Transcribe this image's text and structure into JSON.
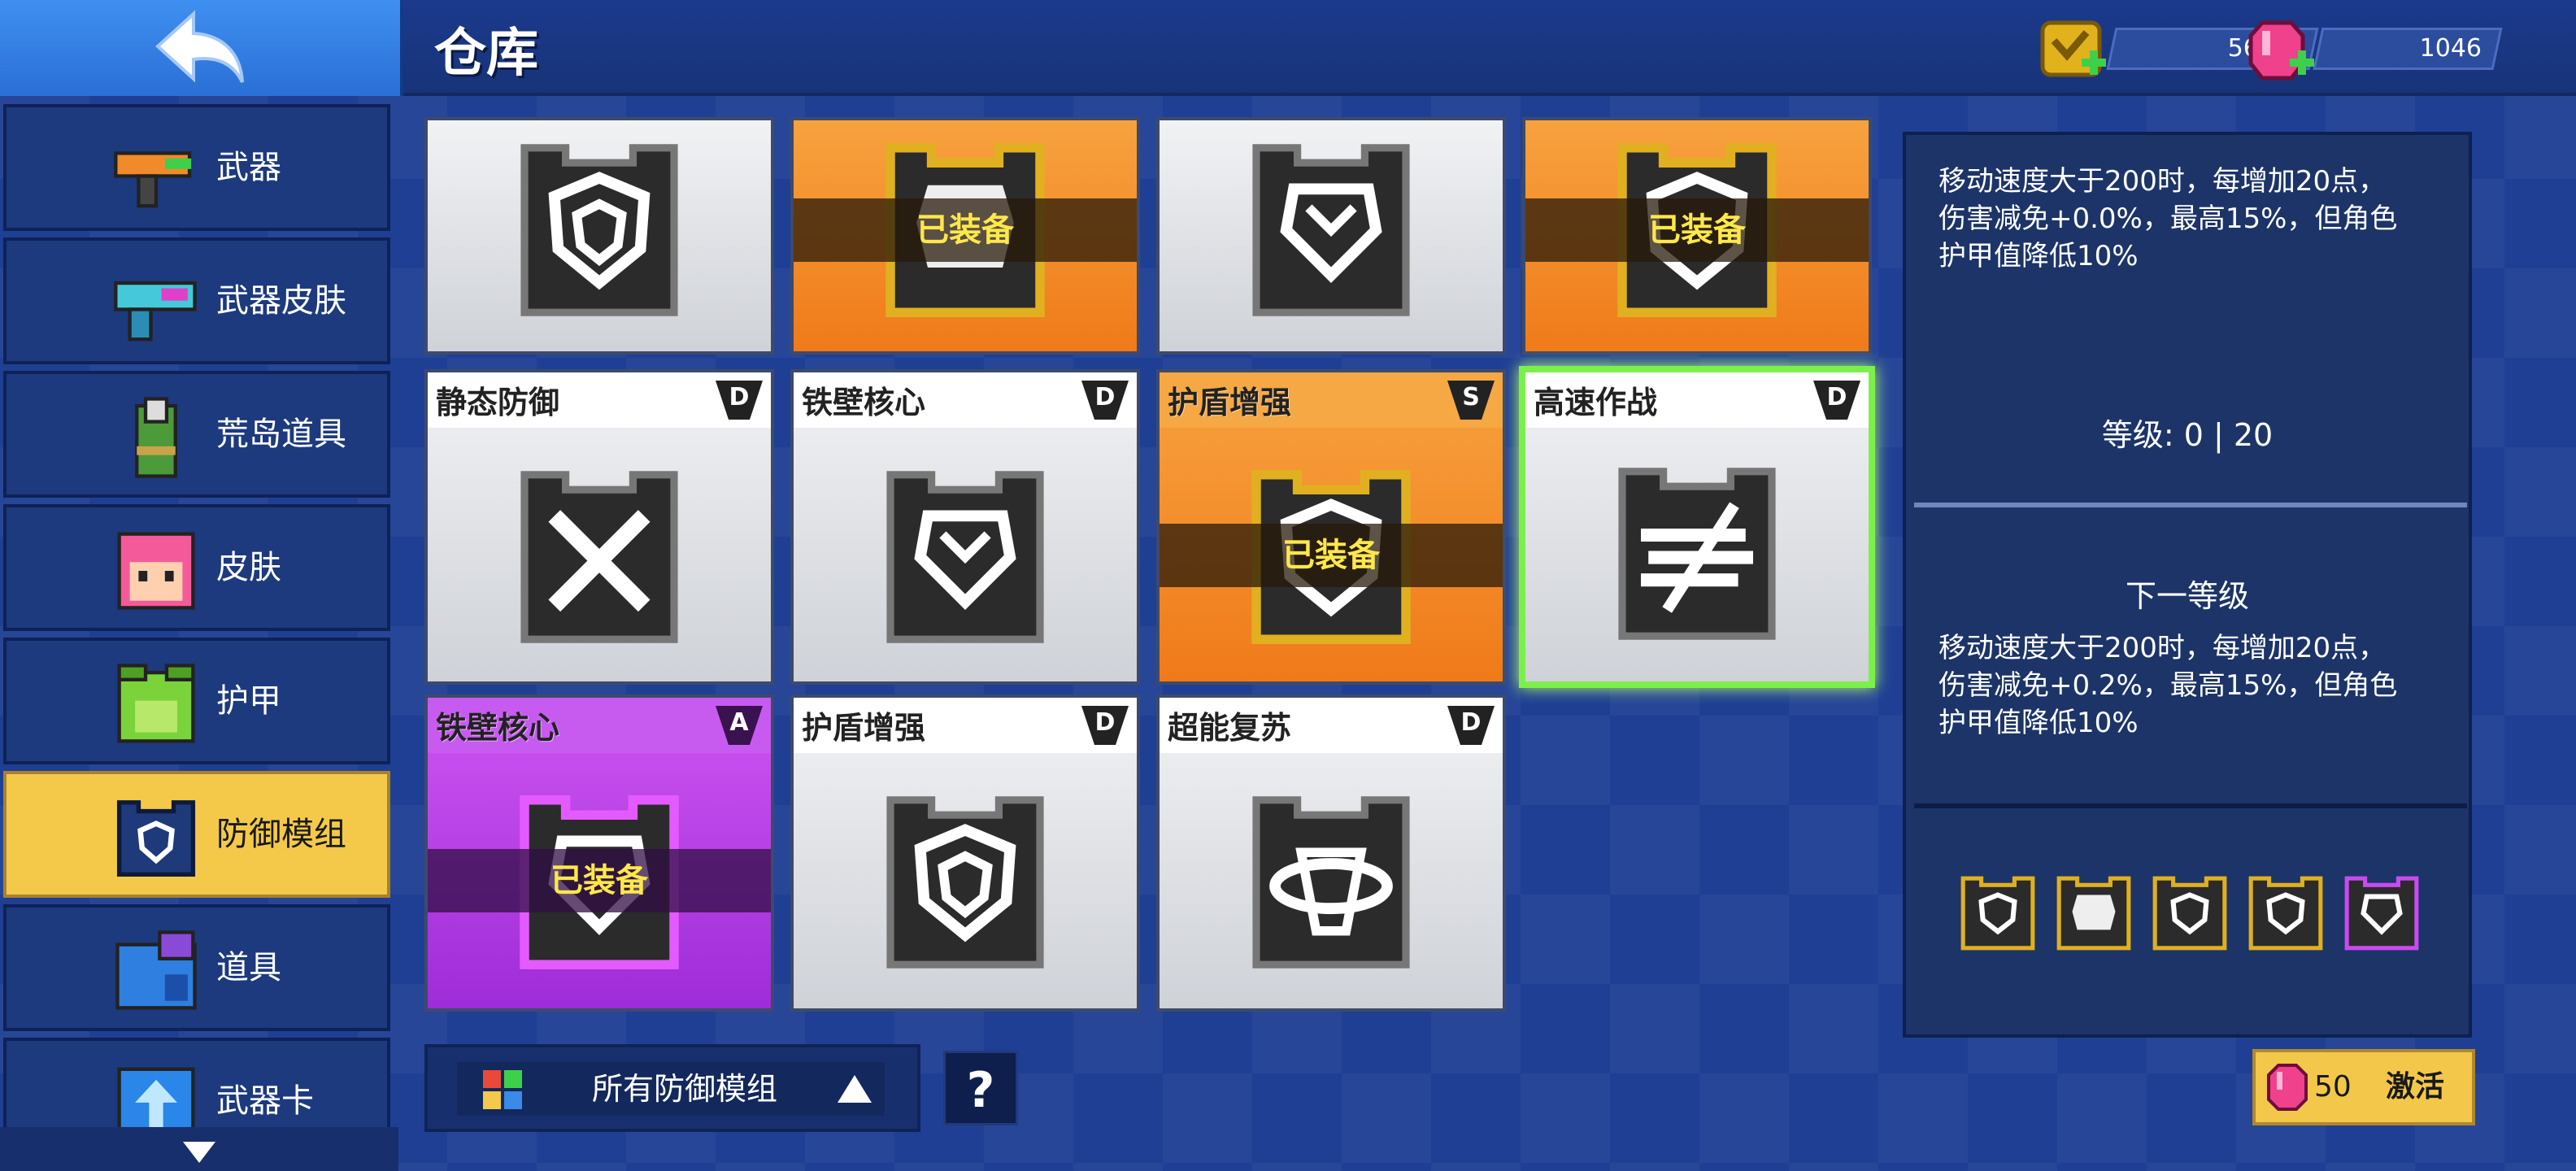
{
  "header": {
    "title": "仓库",
    "coins": "5675",
    "gems": "1046"
  },
  "sidebar": {
    "items": [
      {
        "label": "武器",
        "icon": "weapon-icon"
      },
      {
        "label": "武器皮肤",
        "icon": "weapon-skin-icon"
      },
      {
        "label": "荒岛道具",
        "icon": "island-item-icon"
      },
      {
        "label": "皮肤",
        "icon": "skin-icon"
      },
      {
        "label": "护甲",
        "icon": "armor-icon"
      },
      {
        "label": "防御模组",
        "icon": "defense-module-icon"
      },
      {
        "label": "道具",
        "icon": "item-icon"
      },
      {
        "label": "武器卡",
        "icon": "weapon-card-icon"
      }
    ],
    "active_index": 5
  },
  "grid": {
    "equipped_label": "已装备",
    "row1": [
      {
        "name": "",
        "grade": "",
        "style": "gray",
        "equipped": false
      },
      {
        "name": "",
        "grade": "",
        "style": "orange",
        "equipped": true
      },
      {
        "name": "",
        "grade": "",
        "style": "gray",
        "equipped": false
      },
      {
        "name": "",
        "grade": "",
        "style": "orange",
        "equipped": true
      }
    ],
    "row2": [
      {
        "name": "静态防御",
        "grade": "D",
        "style": "gray",
        "equipped": false
      },
      {
        "name": "铁壁核心",
        "grade": "D",
        "style": "gray",
        "equipped": false
      },
      {
        "name": "护盾增强",
        "grade": "S",
        "style": "orange",
        "equipped": true
      },
      {
        "name": "高速作战",
        "grade": "D",
        "style": "gray",
        "equipped": false,
        "selected": true
      }
    ],
    "row3": [
      {
        "name": "铁壁核心",
        "grade": "A",
        "style": "purple",
        "equipped": true
      },
      {
        "name": "护盾增强",
        "grade": "D",
        "style": "gray",
        "equipped": false
      },
      {
        "name": "超能复苏",
        "grade": "D",
        "style": "gray",
        "equipped": false
      }
    ]
  },
  "filter": {
    "label": "所有防御模组"
  },
  "help_label": "?",
  "detail": {
    "current_desc": [
      "移动速度大于200时，每增加20点，",
      "伤害减免+0.0%，最高15%，但角色",
      "护甲值降低10%"
    ],
    "level": "等级: 0 | 20",
    "next_title": "下一等级",
    "next_desc": [
      "移动速度大于200时，每增加20点，",
      "伤害减免+0.2%，最高15%，但角色",
      "护甲值降低10%"
    ]
  },
  "activate": {
    "cost": "50",
    "label": "激活"
  },
  "colors": {
    "equipped_text": "#ffe84a",
    "active_tab": "#f4c94a",
    "selected_border": "#7cf04a"
  }
}
